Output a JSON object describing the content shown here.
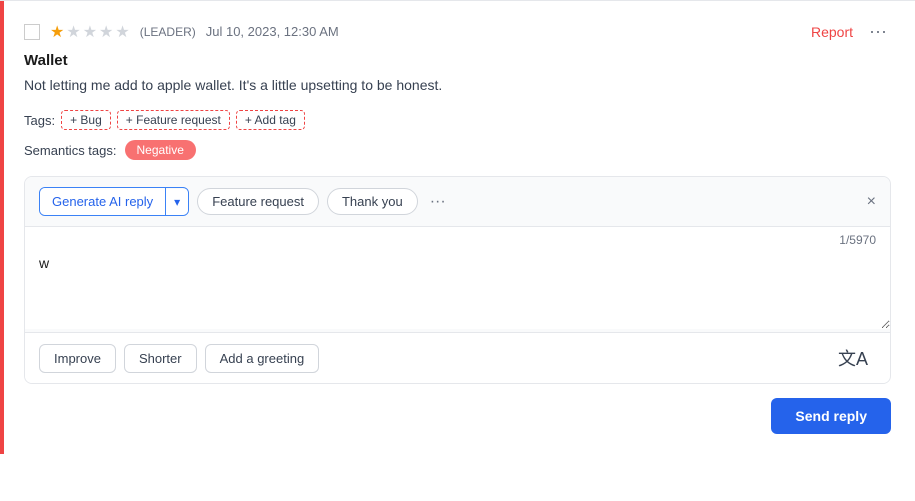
{
  "card": {
    "stars": [
      true,
      false,
      false,
      false,
      false
    ],
    "leader": "(LEADER)",
    "date": "Jul 10, 2023, 12:30 AM",
    "report_label": "Report",
    "more_label": "···",
    "title": "Wallet",
    "body": "Not letting me add to apple wallet. It's a little upsetting to be honest.",
    "tags_label": "Tags:",
    "tags": [
      "+ Bug",
      "+ Feature request"
    ],
    "add_tag_label": "+ Add tag",
    "semantics_label": "Semantics tags:",
    "semantic_tag": "Negative"
  },
  "reply": {
    "generate_btn_label": "Generate AI reply",
    "dropdown_arrow": "▾",
    "chips": [
      "Feature request",
      "Thank you"
    ],
    "more_chips_label": "···",
    "close_label": "×",
    "char_count": "1/5970",
    "textarea_value": "w",
    "textarea_placeholder": "",
    "improve_label": "Improve",
    "shorter_label": "Shorter",
    "add_greeting_label": "Add a greeting",
    "translate_icon": "文A",
    "send_label": "Send reply"
  }
}
